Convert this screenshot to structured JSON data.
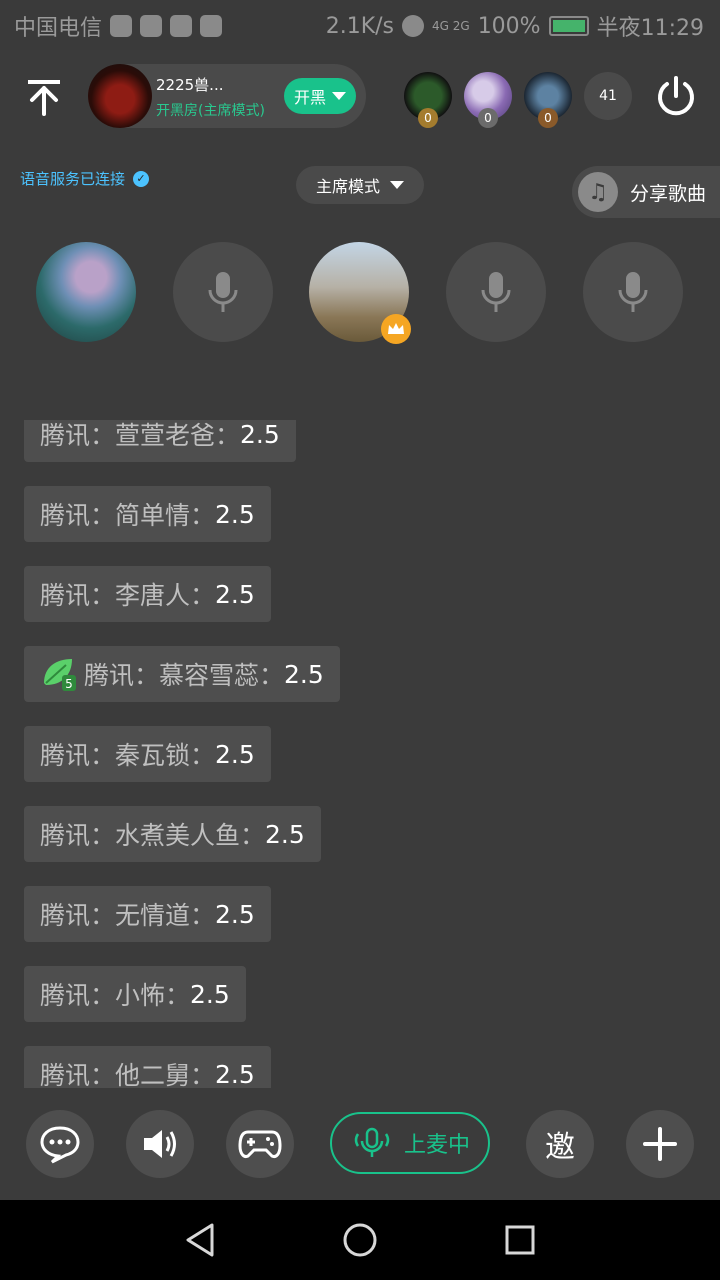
{
  "statusbar": {
    "carrier": "中国电信",
    "speed": "2.1K/s",
    "network": "4G 2G",
    "battery": "100%",
    "time": "半夜11:29"
  },
  "room": {
    "name": "2225兽...",
    "subtitle": "开黑房(主席模式)",
    "start_label": "开黑"
  },
  "viewers": [
    {
      "badge": "0"
    },
    {
      "badge": "0"
    },
    {
      "badge": "0"
    }
  ],
  "viewer_count": "41",
  "voice_status": "语音服务已连接",
  "mode_label": "主席模式",
  "share_label": "分享歌曲",
  "chat": [
    {
      "label": "腾讯：萱萱老爸：",
      "value": "2.5",
      "leaf": false
    },
    {
      "label": "腾讯：简单情：",
      "value": "2.5",
      "leaf": false
    },
    {
      "label": "腾讯：李唐人：",
      "value": "2.5",
      "leaf": false
    },
    {
      "label": "腾讯：慕容雪蕊：",
      "value": "2.5",
      "leaf": true
    },
    {
      "label": "腾讯：秦瓦锁：",
      "value": "2.5",
      "leaf": false
    },
    {
      "label": "腾讯：水煮美人鱼：",
      "value": "2.5",
      "leaf": false
    },
    {
      "label": "腾讯：无情道：",
      "value": "2.5",
      "leaf": false
    },
    {
      "label": "腾讯：小怖：",
      "value": "2.5",
      "leaf": false
    },
    {
      "label": "腾讯：他二舅：",
      "value": "2.5",
      "leaf": false
    }
  ],
  "toolbar": {
    "mic_on_label": "上麦中",
    "invite_label": "邀"
  },
  "colors": {
    "accent": "#19c28b",
    "voice": "#4cc3ff",
    "crown": "#f5a623"
  }
}
